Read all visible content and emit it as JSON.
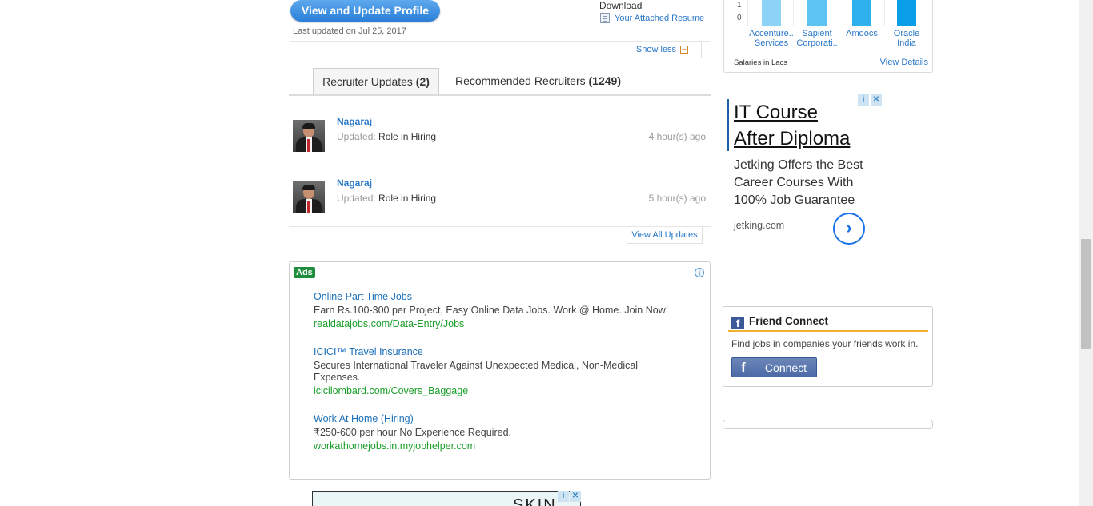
{
  "profile": {
    "update_button": "View and Update Profile",
    "last_updated": "Last updated on Jul 25, 2017",
    "download_label": "Download",
    "resume_link": "Your Attached Resume",
    "show_less": "Show less"
  },
  "tabs": [
    {
      "label": "Recruiter Updates",
      "count": "(2)"
    },
    {
      "label": "Recommended Recruiters",
      "count": "(1249)"
    }
  ],
  "updates": [
    {
      "name": "Nagaraj",
      "prefix": "Updated:",
      "text": "Role in Hiring",
      "time": "4 hour(s) ago"
    },
    {
      "name": "Nagaraj",
      "prefix": "Updated:",
      "text": "Role in Hiring",
      "time": "5 hour(s) ago"
    }
  ],
  "view_all_updates": "View All Updates",
  "ads": {
    "badge": "Ads",
    "items": [
      {
        "title": "Online Part Time Jobs",
        "desc": "Earn Rs.100-300 per Project, Easy Online Data Jobs. Work @ Home. Join Now!",
        "url": "realdatajobs.com/Data-Entry/Jobs"
      },
      {
        "title": "ICICI™ Travel Insurance",
        "desc": "Secures International Traveler Against Unexpected Medical, Non-Medical Expenses.",
        "url": "icicilombard.com/Covers_Baggage"
      },
      {
        "title": "Work At Home (Hiring)",
        "desc": "₹250-600 per hour No Experience Required.",
        "url": "workathomejobs.in.myjobhelper.com"
      }
    ]
  },
  "bottom_ad_text": "SKIN",
  "salary_widget": {
    "ticks": [
      "1",
      "0"
    ],
    "companies": [
      {
        "line1": "Accenture..",
        "line2": "Services"
      },
      {
        "line1": "Sapient",
        "line2": "Corporati.."
      },
      {
        "line1": "Amdocs",
        "line2": ""
      },
      {
        "line1": "Oracle",
        "line2": "India"
      }
    ],
    "bar_colors": [
      "#8dd3f7",
      "#5cc3f2",
      "#2fb1ee",
      "#0a9de8"
    ],
    "footer": "Salaries in Lacs",
    "view_details": "View Details"
  },
  "google_ad": {
    "title_line1": "IT Course",
    "title_line2": "After Diploma",
    "desc": "Jetking Offers the Best Career Courses With 100% Job Guarantee",
    "domain": "jetking.com"
  },
  "friend_connect": {
    "title": "Friend Connect",
    "desc": "Find jobs in companies your friends work in.",
    "button": "Connect"
  }
}
